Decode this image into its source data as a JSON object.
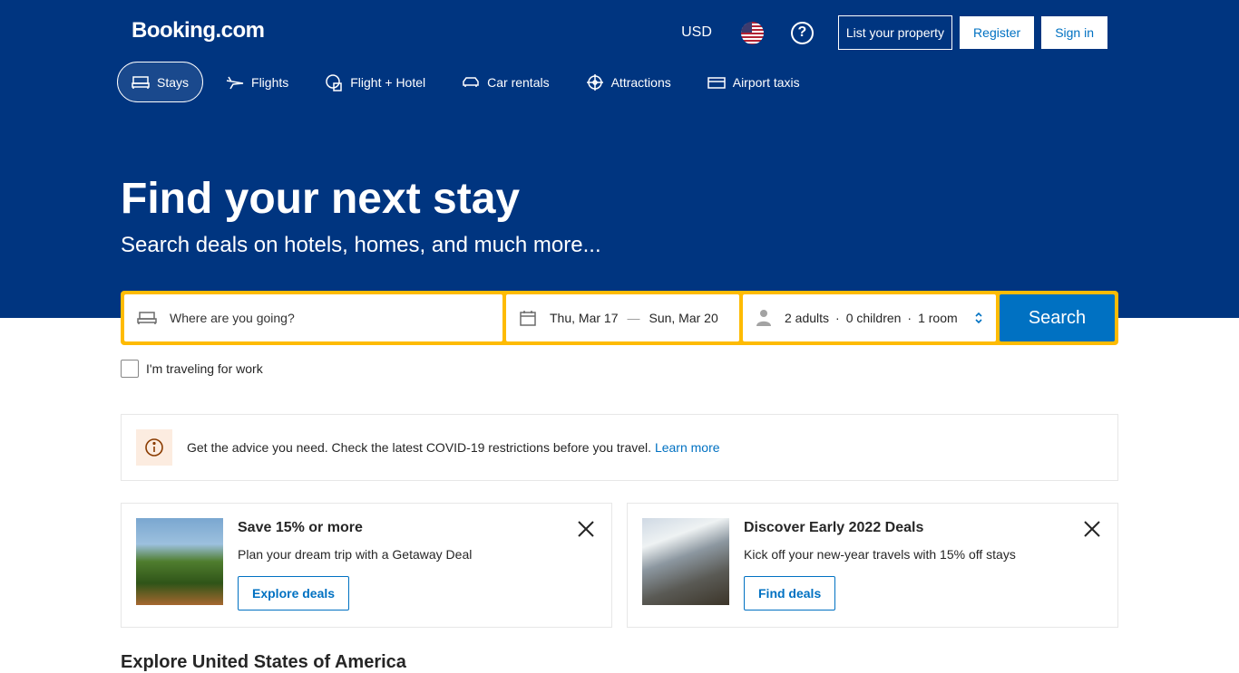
{
  "header": {
    "logo": "Booking.com",
    "currency": "USD",
    "help_label": "?",
    "list_property": "List your property",
    "register": "Register",
    "sign_in": "Sign in"
  },
  "nav": {
    "items": [
      {
        "label": "Stays",
        "icon": "bed-icon",
        "active": true
      },
      {
        "label": "Flights",
        "icon": "plane-icon"
      },
      {
        "label": "Flight + Hotel",
        "icon": "flight-hotel-icon"
      },
      {
        "label": "Car rentals",
        "icon": "car-icon"
      },
      {
        "label": "Attractions",
        "icon": "attractions-icon"
      },
      {
        "label": "Airport taxis",
        "icon": "taxi-icon"
      }
    ]
  },
  "hero": {
    "title": "Find your next stay",
    "subtitle": "Search deals on hotels, homes, and much more..."
  },
  "search": {
    "destination_placeholder": "Where are you going?",
    "checkin": "Thu, Mar 17",
    "dash": "—",
    "checkout": "Sun, Mar 20",
    "adults": "2 adults",
    "children": "0 children",
    "rooms": "1 room",
    "separator": "·",
    "button": "Search"
  },
  "work_label": "I'm traveling for work",
  "covid": {
    "text": "Get the advice you need. Check the latest COVID-19 restrictions before you travel.",
    "link": "Learn more"
  },
  "cards": [
    {
      "title": "Save 15% or more",
      "text": "Plan your dream trip with a Getaway Deal",
      "button": "Explore deals"
    },
    {
      "title": "Discover Early 2022 Deals",
      "text": "Kick off your new-year travels with 15% off stays",
      "button": "Find deals"
    }
  ],
  "explore_title": "Explore United States of America",
  "colors": {
    "brand": "#003580",
    "accent": "#0071c2",
    "search_border": "#febb02"
  }
}
